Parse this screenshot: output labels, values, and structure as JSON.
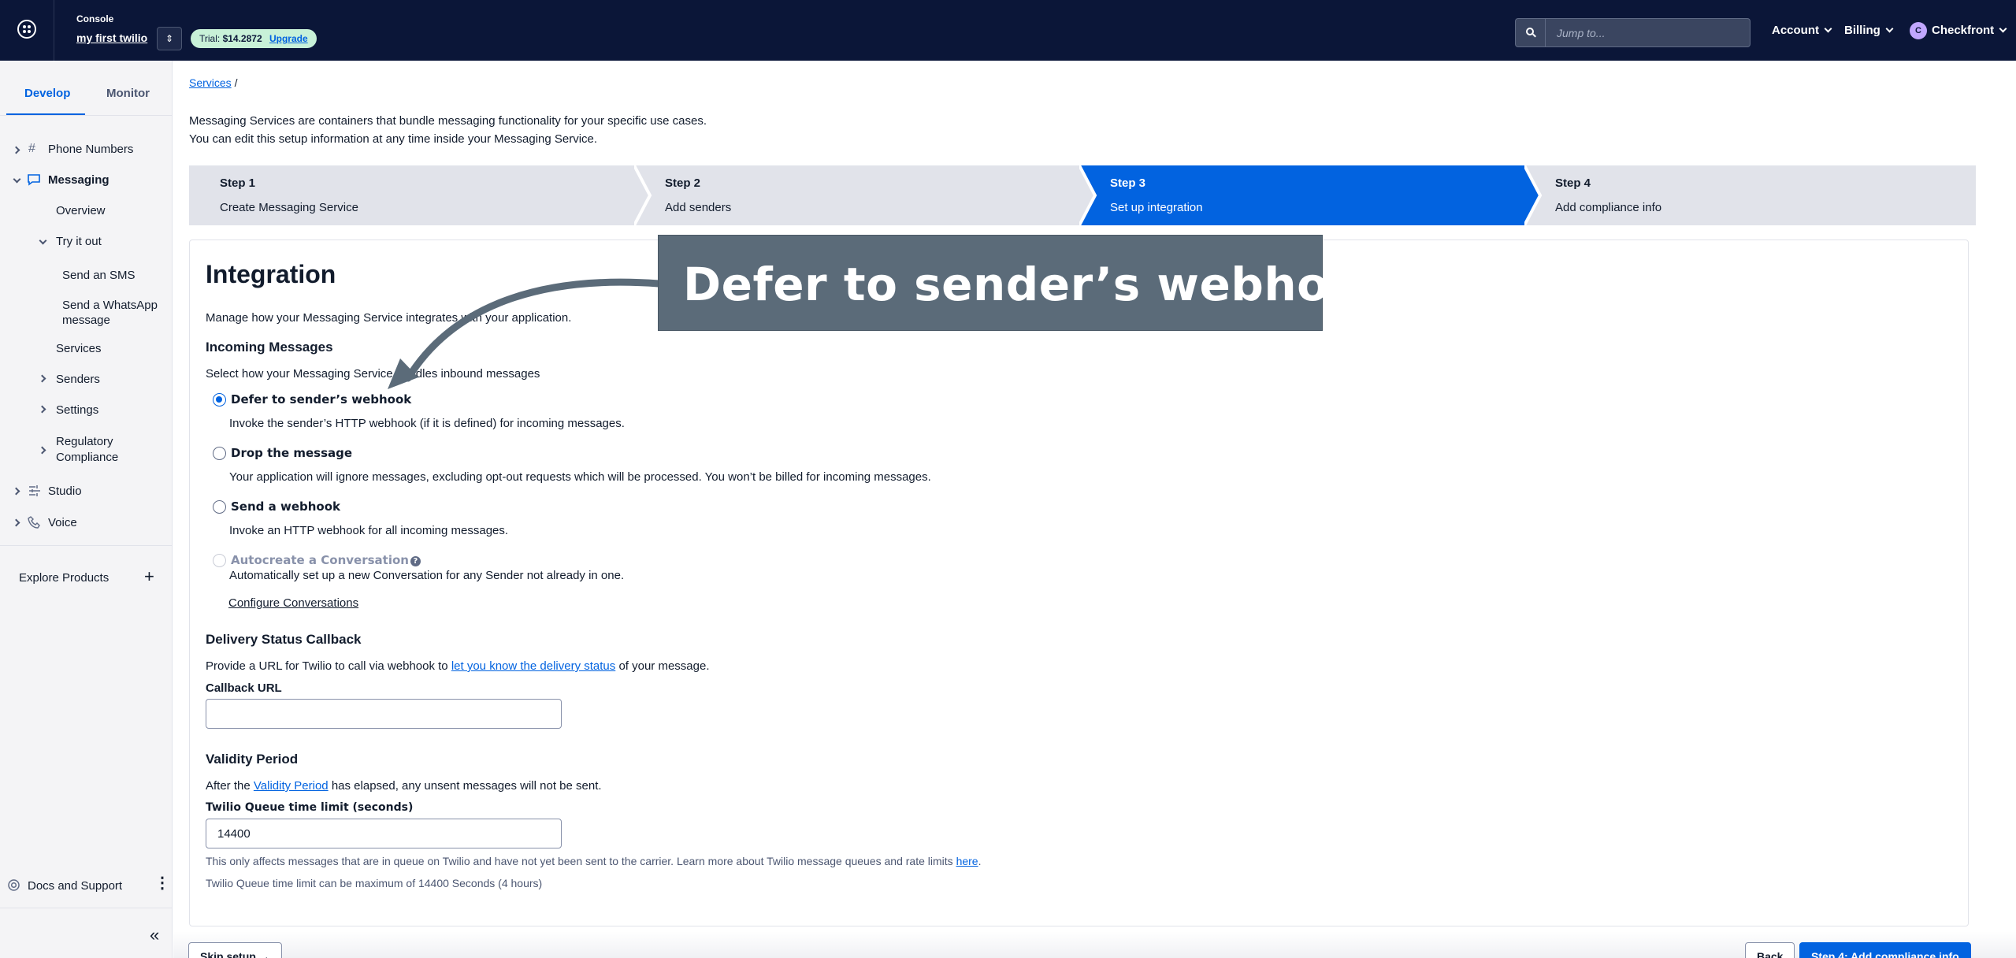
{
  "topbar": {
    "console_label": "Console",
    "account_name": "my first twilio",
    "trial_label": "Trial:",
    "trial_amount": "$14.2872",
    "upgrade": "Upgrade",
    "search_placeholder": "Jump to...",
    "account_menu": "Account",
    "billing_menu": "Billing",
    "user_initial": "C",
    "user_name": "Checkfront"
  },
  "sidebar": {
    "tabs": [
      "Develop",
      "Monitor"
    ],
    "items": {
      "phone_numbers": "Phone Numbers",
      "messaging": "Messaging",
      "overview": "Overview",
      "try_it_out": "Try it out",
      "send_sms": "Send an SMS",
      "send_whatsapp_1": "Send a WhatsApp",
      "send_whatsapp_2": "message",
      "services": "Services",
      "senders": "Senders",
      "settings": "Settings",
      "regulatory_1": "Regulatory",
      "regulatory_2": "Compliance",
      "studio": "Studio",
      "voice": "Voice"
    },
    "explore_products": "Explore Products",
    "docs_support": "Docs and Support"
  },
  "main": {
    "breadcrumb_link": "Services",
    "breadcrumb_sep": "/",
    "intro_line1": "Messaging Services are containers that bundle messaging functionality for your specific use cases.",
    "intro_line2": "You can edit this setup information at any time inside your Messaging Service.",
    "steps": [
      {
        "num": "Step 1",
        "title": "Create Messaging Service"
      },
      {
        "num": "Step 2",
        "title": "Add senders"
      },
      {
        "num": "Step 3",
        "title": "Set up integration"
      },
      {
        "num": "Step 4",
        "title": "Add compliance info"
      }
    ],
    "integration": {
      "heading": "Integration",
      "description": "Manage how your Messaging Service integrates with your application.",
      "incoming_heading": "Incoming Messages",
      "incoming_desc": "Select how your Messaging Service handles inbound messages",
      "options": [
        {
          "label": "Defer to sender’s webhook",
          "desc": "Invoke the sender’s HTTP webhook (if it is defined) for incoming messages."
        },
        {
          "label": "Drop the message",
          "desc": "Your application will ignore messages, excluding opt-out requests which will be processed. You won’t be billed for incoming messages."
        },
        {
          "label": "Send a webhook",
          "desc": "Invoke an HTTP webhook for all incoming messages."
        },
        {
          "label": "Autocreate a Conversation",
          "desc": "Automatically set up a new Conversation for any Sender not already in one."
        }
      ],
      "configure_link": "Configure Conversations",
      "delivery_heading": "Delivery Status Callback",
      "delivery_pre": "Provide a URL for Twilio to call via webhook to ",
      "delivery_link": "let you know the delivery status",
      "delivery_post": " of your message.",
      "callback_label": "Callback URL",
      "callback_value": "",
      "validity_heading": "Validity Period",
      "validity_pre": "After the ",
      "validity_link": "Validity Period",
      "validity_post": " has elapsed, any unsent messages will not be sent.",
      "queue_label": "Twilio Queue time limit (seconds)",
      "queue_value": "14400",
      "queue_note_pre": "This only affects messages that are in queue on Twilio and have not yet been sent to the carrier. Learn more about Twilio message queues and rate limits ",
      "queue_note_link": "here",
      "queue_note_post": ".",
      "queue_max": "Twilio Queue time limit can be maximum of 14400 Seconds (4 hours)"
    },
    "annotation": "Defer to sender’s webhook"
  },
  "footer": {
    "skip": "Skip setup →",
    "back": "Back",
    "next": "Step 4: Add compliance info"
  },
  "colors": {
    "topbar_bg": "#0b1638",
    "accent": "#0263e0",
    "step_inactive": "#e1e3ea",
    "annotation_bg": "#5b6b79"
  }
}
